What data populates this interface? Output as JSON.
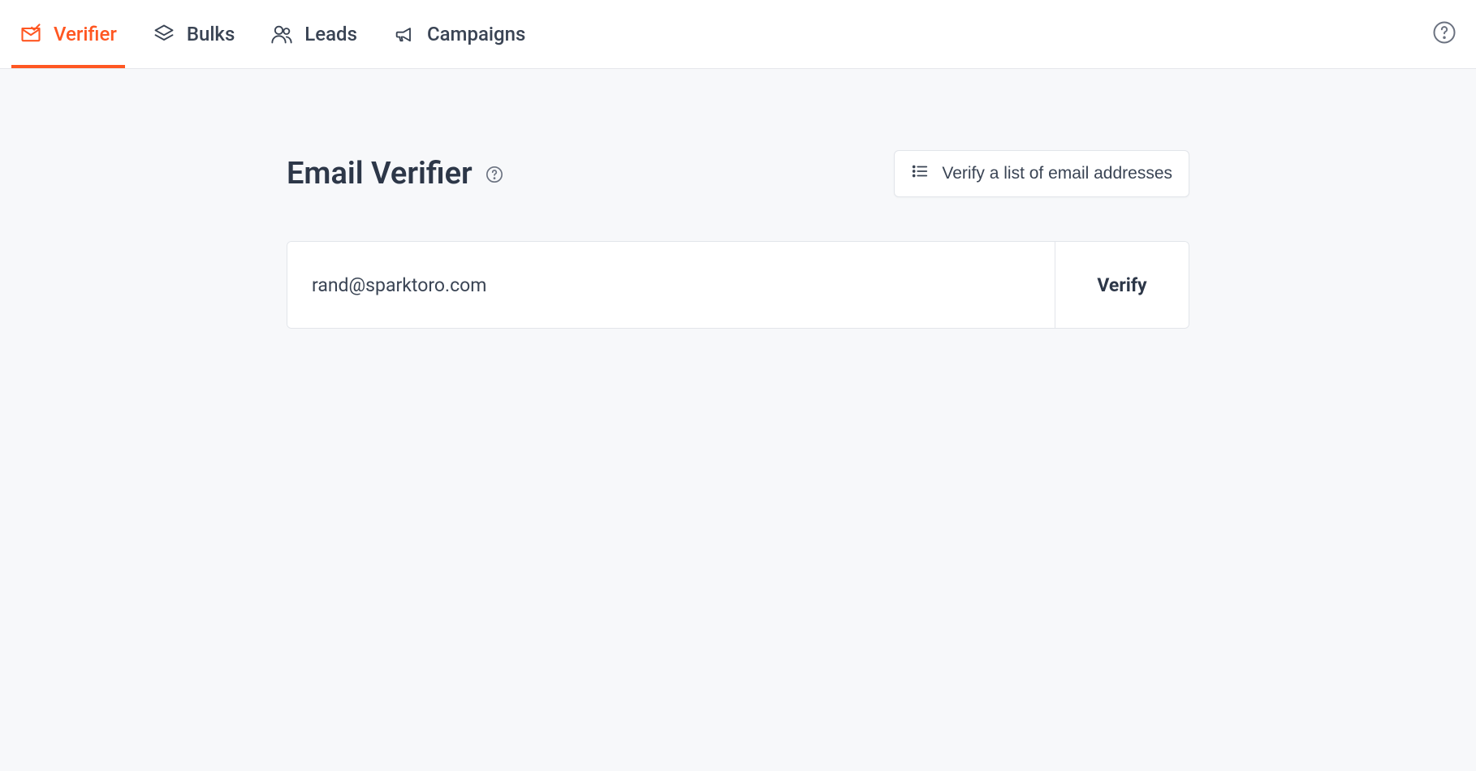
{
  "nav": {
    "items": [
      {
        "label": "Verifier",
        "active": true
      },
      {
        "label": "Bulks",
        "active": false
      },
      {
        "label": "Leads",
        "active": false
      },
      {
        "label": "Campaigns",
        "active": false
      }
    ]
  },
  "page": {
    "title": "Email Verifier"
  },
  "actions": {
    "verify_list_label": "Verify a list of email addresses",
    "verify_button_label": "Verify"
  },
  "form": {
    "email_value": "rand@sparktoro.com"
  },
  "colors": {
    "accent": "#ff5722",
    "text": "#3a4454",
    "title": "#2d3748",
    "border": "#e2e5ea",
    "bg": "#f7f8fa"
  }
}
